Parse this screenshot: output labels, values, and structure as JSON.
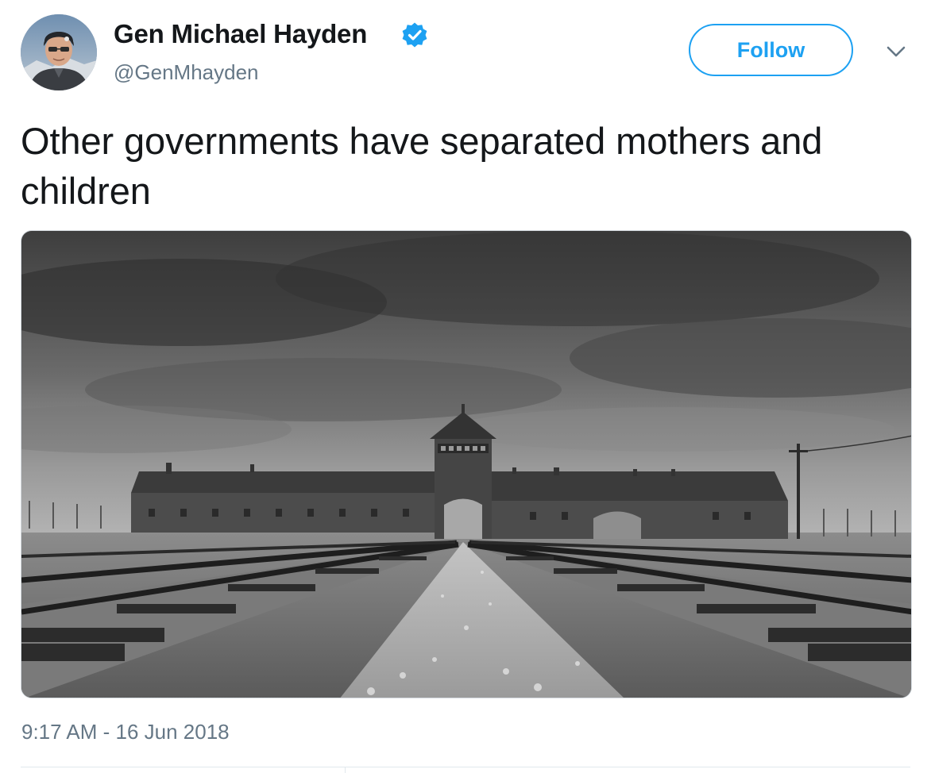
{
  "author": {
    "display_name": "Gen Michael Hayden",
    "handle": "@GenMhayden",
    "verified": true,
    "avatar_icon": "user-avatar-photo"
  },
  "actions": {
    "follow_label": "Follow",
    "more_icon": "chevron-down-icon"
  },
  "tweet": {
    "text": "Other governments have separated mothers and children",
    "timestamp": "9:17 AM - 16 Jun 2018"
  },
  "media": {
    "type": "photo"
  },
  "colors": {
    "accent": "#1da1f2",
    "text_primary": "#14171a",
    "text_secondary": "#657786",
    "border": "#e1e8ed"
  }
}
